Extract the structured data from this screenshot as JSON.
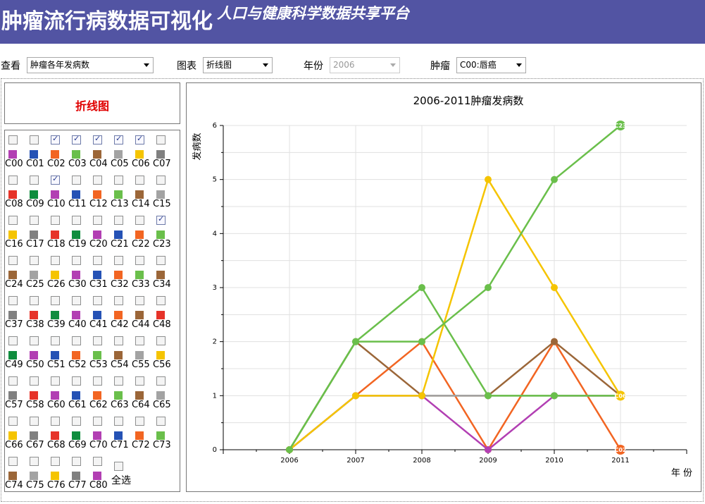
{
  "header": {
    "title": "肿瘤流行病数据可视化",
    "subtitle": "人口与健康科学数据共享平台",
    "bg_color": "#5254a3"
  },
  "controls": {
    "view_label": "查看",
    "view_value": "肿瘤各年发病数",
    "chart_label": "图表",
    "chart_value": "折线图",
    "year_label": "年份",
    "year_value": "2006",
    "tumor_label": "肿瘤",
    "tumor_value": "C00:唇癌"
  },
  "panel": {
    "chart_type_title": "折线图",
    "select_all_label": "全选",
    "tumors": [
      {
        "code": "C00",
        "color": "#b23fb3",
        "checked": false
      },
      {
        "code": "C01",
        "color": "#2552b5",
        "checked": false
      },
      {
        "code": "C02",
        "color": "#f26522",
        "checked": true
      },
      {
        "code": "C03",
        "color": "#6abf4b",
        "checked": true
      },
      {
        "code": "C04",
        "color": "#9b6638",
        "checked": true
      },
      {
        "code": "C05",
        "color": "#a3a3a3",
        "checked": true
      },
      {
        "code": "C06",
        "color": "#f5c400",
        "checked": true
      },
      {
        "code": "C07",
        "color": "#808080",
        "checked": false
      },
      {
        "code": "C08",
        "color": "#e63329",
        "checked": false
      },
      {
        "code": "C09",
        "color": "#0f8d3e",
        "checked": false
      },
      {
        "code": "C10",
        "color": "#b23fb3",
        "checked": true
      },
      {
        "code": "C11",
        "color": "#2552b5",
        "checked": false
      },
      {
        "code": "C12",
        "color": "#f26522",
        "checked": false
      },
      {
        "code": "C13",
        "color": "#6abf4b",
        "checked": false
      },
      {
        "code": "C14",
        "color": "#9b6638",
        "checked": false
      },
      {
        "code": "C15",
        "color": "#a3a3a3",
        "checked": false
      },
      {
        "code": "C16",
        "color": "#f5c400",
        "checked": false
      },
      {
        "code": "C17",
        "color": "#808080",
        "checked": false
      },
      {
        "code": "C18",
        "color": "#e63329",
        "checked": false
      },
      {
        "code": "C19",
        "color": "#0f8d3e",
        "checked": false
      },
      {
        "code": "C20",
        "color": "#b23fb3",
        "checked": false
      },
      {
        "code": "C21",
        "color": "#2552b5",
        "checked": false
      },
      {
        "code": "C22",
        "color": "#f26522",
        "checked": false
      },
      {
        "code": "C23",
        "color": "#6abf4b",
        "checked": true
      },
      {
        "code": "C24",
        "color": "#9b6638",
        "checked": false
      },
      {
        "code": "C25",
        "color": "#a3a3a3",
        "checked": false
      },
      {
        "code": "C26",
        "color": "#f5c400",
        "checked": false
      },
      {
        "code": "C30",
        "color": "#b23fb3",
        "checked": false
      },
      {
        "code": "C31",
        "color": "#2552b5",
        "checked": false
      },
      {
        "code": "C32",
        "color": "#f26522",
        "checked": false
      },
      {
        "code": "C33",
        "color": "#6abf4b",
        "checked": false
      },
      {
        "code": "C34",
        "color": "#9b6638",
        "checked": false
      },
      {
        "code": "C37",
        "color": "#808080",
        "checked": false
      },
      {
        "code": "C38",
        "color": "#e63329",
        "checked": false
      },
      {
        "code": "C39",
        "color": "#0f8d3e",
        "checked": false
      },
      {
        "code": "C40",
        "color": "#b23fb3",
        "checked": false
      },
      {
        "code": "C41",
        "color": "#2552b5",
        "checked": false
      },
      {
        "code": "C42",
        "color": "#f26522",
        "checked": false
      },
      {
        "code": "C44",
        "color": "#9b6638",
        "checked": false
      },
      {
        "code": "C48",
        "color": "#e63329",
        "checked": false
      },
      {
        "code": "C49",
        "color": "#0f8d3e",
        "checked": false
      },
      {
        "code": "C50",
        "color": "#b23fb3",
        "checked": false
      },
      {
        "code": "C51",
        "color": "#2552b5",
        "checked": false
      },
      {
        "code": "C52",
        "color": "#f26522",
        "checked": false
      },
      {
        "code": "C53",
        "color": "#6abf4b",
        "checked": false
      },
      {
        "code": "C54",
        "color": "#9b6638",
        "checked": false
      },
      {
        "code": "C55",
        "color": "#a3a3a3",
        "checked": false
      },
      {
        "code": "C56",
        "color": "#f5c400",
        "checked": false
      },
      {
        "code": "C57",
        "color": "#808080",
        "checked": false
      },
      {
        "code": "C58",
        "color": "#e63329",
        "checked": false
      },
      {
        "code": "C60",
        "color": "#b23fb3",
        "checked": false
      },
      {
        "code": "C61",
        "color": "#2552b5",
        "checked": false
      },
      {
        "code": "C62",
        "color": "#f26522",
        "checked": false
      },
      {
        "code": "C63",
        "color": "#6abf4b",
        "checked": false
      },
      {
        "code": "C64",
        "color": "#9b6638",
        "checked": false
      },
      {
        "code": "C65",
        "color": "#a3a3a3",
        "checked": false
      },
      {
        "code": "C66",
        "color": "#f5c400",
        "checked": false
      },
      {
        "code": "C67",
        "color": "#808080",
        "checked": false
      },
      {
        "code": "C68",
        "color": "#e63329",
        "checked": false
      },
      {
        "code": "C69",
        "color": "#0f8d3e",
        "checked": false
      },
      {
        "code": "C70",
        "color": "#b23fb3",
        "checked": false
      },
      {
        "code": "C71",
        "color": "#2552b5",
        "checked": false
      },
      {
        "code": "C72",
        "color": "#f26522",
        "checked": false
      },
      {
        "code": "C73",
        "color": "#6abf4b",
        "checked": false
      },
      {
        "code": "C74",
        "color": "#9b6638",
        "checked": false
      },
      {
        "code": "C75",
        "color": "#a3a3a3",
        "checked": false
      },
      {
        "code": "C76",
        "color": "#f5c400",
        "checked": false
      },
      {
        "code": "C77",
        "color": "#808080",
        "checked": false
      },
      {
        "code": "C80",
        "color": "#b23fb3",
        "checked": false
      }
    ]
  },
  "chart_data": {
    "type": "line",
    "title": "2006-2011肿瘤发病数",
    "xlabel": "年 份",
    "ylabel": "发病数",
    "x": [
      2006,
      2007,
      2008,
      2009,
      2010,
      2011
    ],
    "ylim": [
      0,
      6
    ],
    "yticks": [
      0,
      1,
      2,
      3,
      4,
      5,
      6
    ],
    "grid": true,
    "legend": "none",
    "series": [
      {
        "name": "C02",
        "color": "#f26522",
        "values": [
          0,
          1,
          2,
          0,
          2,
          0
        ],
        "end_label": "C02"
      },
      {
        "name": "C10",
        "color": "#b23fb3",
        "values": [
          0,
          1,
          1,
          0,
          1,
          1
        ],
        "end_label": ""
      },
      {
        "name": "C04",
        "color": "#9b6638",
        "values": [
          0,
          2,
          1,
          1,
          2,
          1
        ],
        "end_label": ""
      },
      {
        "name": "C05",
        "color": "#a3a3a3",
        "values": [
          0,
          1,
          1,
          1,
          1,
          1
        ],
        "end_label": ""
      },
      {
        "name": "C03",
        "color": "#6abf4b",
        "values": [
          0,
          2,
          3,
          1,
          1,
          1
        ],
        "end_label": ""
      },
      {
        "name": "C06",
        "color": "#f5c400",
        "values": [
          0,
          1,
          1,
          5,
          3,
          1
        ],
        "end_label": "C06"
      },
      {
        "name": "C23",
        "color": "#6abf4b",
        "values": [
          0,
          2,
          2,
          3,
          5,
          6
        ],
        "end_label": "C23"
      }
    ]
  }
}
